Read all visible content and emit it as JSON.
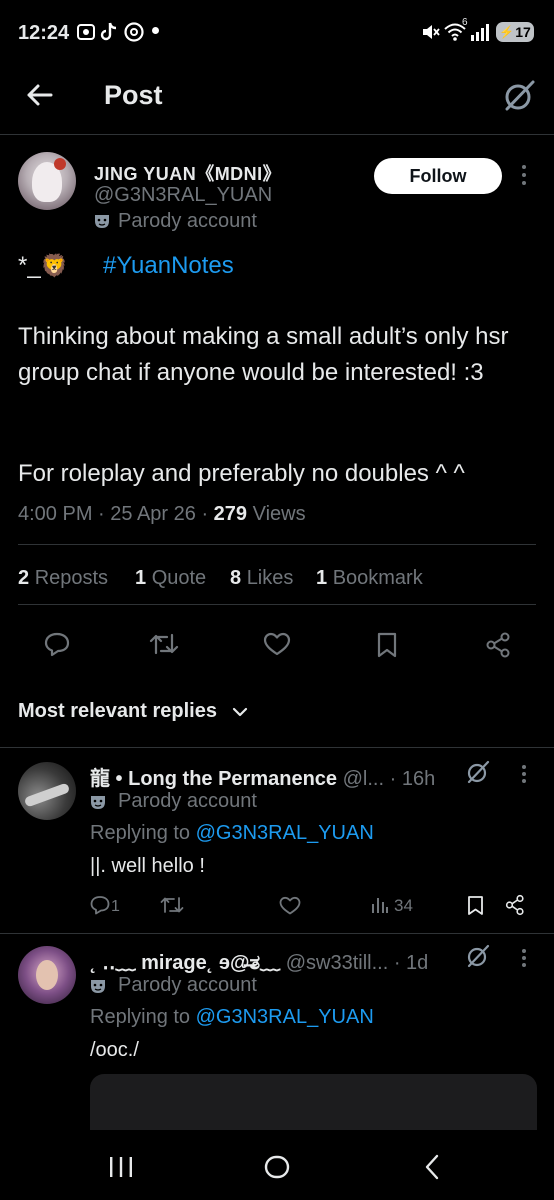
{
  "status_bar": {
    "time": "12:24",
    "battery": "17",
    "signal_badge": "6"
  },
  "header": {
    "title": "Post"
  },
  "post": {
    "author_name": "JING YUAN《MDNI》",
    "author_handle": "@G3N3RAL_YUAN",
    "parody_label": "Parody account",
    "follow_label": "Follow",
    "tag_prefix": "*_",
    "tag_emoji": "🦁",
    "hashtag": "#YuanNotes",
    "paragraph_1": "Thinking about making a small adult’s only hsr group chat if anyone would be interested! :3",
    "paragraph_2": "For roleplay and preferably no doubles ^ ^",
    "timestamp": "4:00 PM · 25 Apr 26 · ",
    "views_count": "279",
    "views_label": " Views",
    "stats": [
      {
        "count": "2",
        "label": "Reposts"
      },
      {
        "count": "1",
        "label": "Quote"
      },
      {
        "count": "8",
        "label": "Likes"
      },
      {
        "count": "1",
        "label": "Bookmark"
      }
    ]
  },
  "replies_section": {
    "sort_label": "Most relevant replies"
  },
  "replies": [
    {
      "name": "龍 • Long the Permanence",
      "handle": "@l...",
      "time": "· 16h",
      "parody_label": "Parody account",
      "replying_prefix": "Replying to ",
      "replying_handle": "@G3N3RAL_YUAN",
      "text": "||. well hello !",
      "reply_count": "1",
      "views": "34"
    },
    {
      "name": "˛ ‥﹏ mirage˛ ɘ@̶̶ತ﹏",
      "handle": "@sw33till...",
      "time": "· 1d",
      "parody_label": "Parody account",
      "replying_prefix": "Replying to ",
      "replying_handle": "@G3N3RAL_YUAN",
      "text": "/ooc./"
    }
  ],
  "colors": {
    "background": "#000000",
    "text": "#e7e9ea",
    "secondary": "#71767b",
    "accent": "#1d9bf0",
    "divider": "#2f3336"
  }
}
